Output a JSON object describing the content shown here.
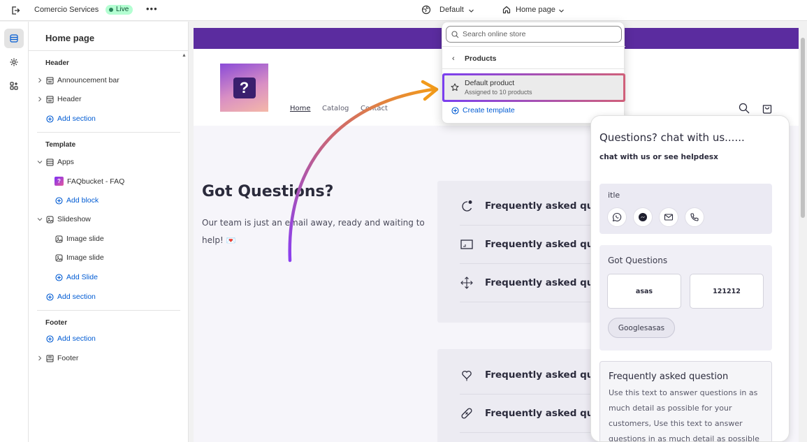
{
  "topbar": {
    "store_name": "Comercio Services",
    "status": "Live",
    "more": "•••",
    "theme_selector": "Default",
    "page_selector": "Home page"
  },
  "sidebar": {
    "title": "Home page",
    "header_group": {
      "heading": "Header",
      "items": [
        "Announcement bar",
        "Header"
      ],
      "add_section": "Add section"
    },
    "template_group": {
      "heading": "Template",
      "apps": "Apps",
      "app_block": "FAQbucket - FAQ",
      "add_block": "Add block",
      "slideshow": "Slideshow",
      "slides": [
        "Image slide",
        "Image slide"
      ],
      "add_slide": "Add Slide",
      "add_section": "Add section"
    },
    "footer_group": {
      "heading": "Footer",
      "add_section": "Add section",
      "footer_item": "Footer"
    }
  },
  "dropdown": {
    "search_placeholder": "Search online store",
    "back_label": "Products",
    "item_title": "Default product",
    "item_subtitle": "Assigned to 10 products",
    "create_label": "Create template"
  },
  "preview": {
    "logo_glyph": "?",
    "nav": [
      "Home",
      "Catalog",
      "Contact"
    ],
    "heading": "Got Questions?",
    "description": "Our team is just an email away, ready and waiting to help!",
    "faq_card_1": [
      "Frequently asked que",
      "Frequently asked que",
      "Frequently asked que"
    ],
    "faq_card_2": [
      "Frequently asked que",
      "Frequently asked que"
    ]
  },
  "chat": {
    "title": "Questions? chat with us......",
    "subtitle": "chat with us or see helpdesx",
    "box1_label": "itle",
    "box2_label": "Got Questions",
    "tiles": [
      "asas",
      "121212"
    ],
    "pill": "Googlesasas",
    "faq_title": "Frequently asked question",
    "faq_body": "Use this text to answer questions in as much detail as possible for your customers, Use this text to answer questions in as much detail as possible"
  },
  "colors": {
    "announcement_bar": "#5b2c9f",
    "live_badge": "#b4fed2",
    "link_blue": "#005bd3",
    "highlight_gradient_start": "#7a3ff0",
    "highlight_gradient_end": "#d0607a",
    "arrow_orange": "#f29a1a",
    "arrow_purple": "#8a3ff0"
  }
}
